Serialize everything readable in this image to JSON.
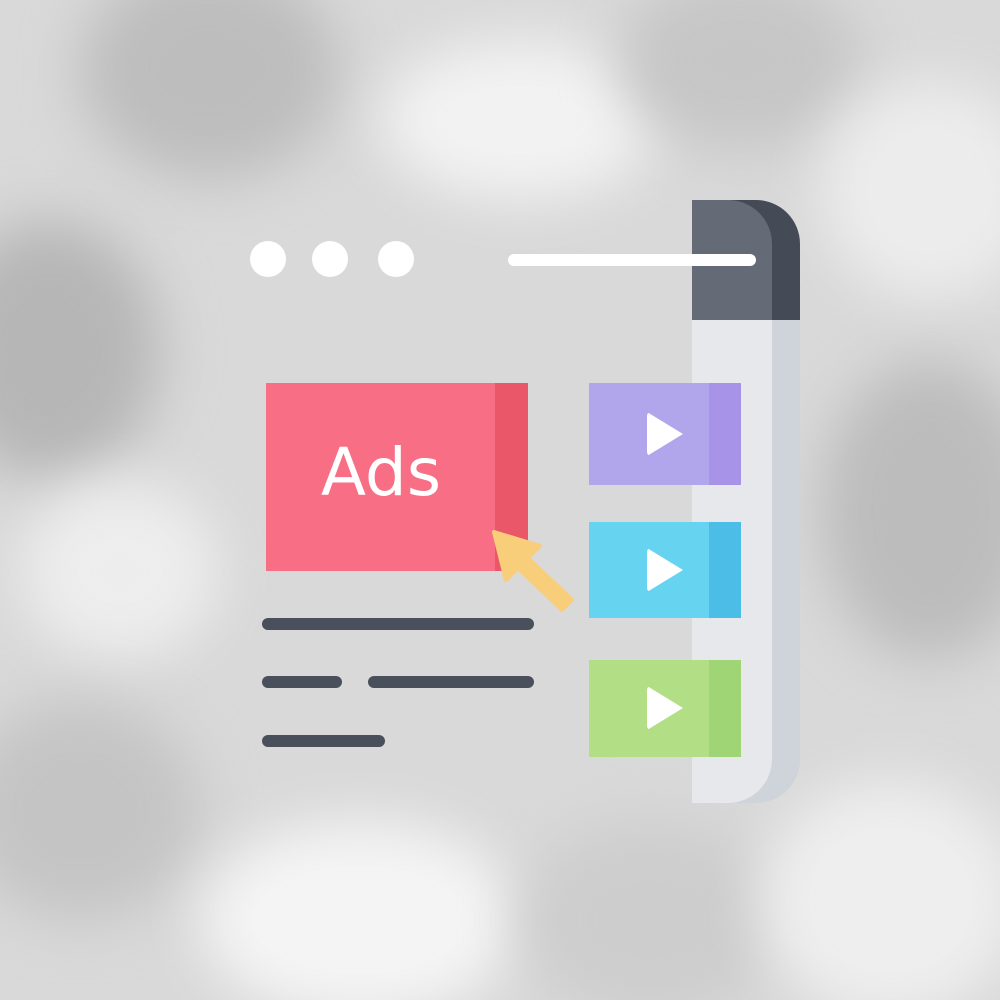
{
  "ad": {
    "label": "Ads"
  },
  "colors": {
    "titlebar": "#646b77",
    "titlebar_edge": "#454b56",
    "window_body": "#e6e8eb",
    "window_edge": "#cfd3da",
    "ad_primary": "#f76e85",
    "ad_shade": "#ea5769",
    "video_purple": "#b1a5ec",
    "video_purple_shade": "#a793e8",
    "video_blue": "#66d3f0",
    "video_blue_shade": "#4bbde6",
    "video_green": "#b2df86",
    "video_green_shade": "#a0d575",
    "text_line": "#4a505b",
    "cursor": "#f9ce7a"
  },
  "icons": {
    "window_dots": [
      "dot-icon",
      "dot-icon",
      "dot-icon"
    ],
    "video_play": "play-icon",
    "pointer": "cursor-arrow-icon"
  }
}
